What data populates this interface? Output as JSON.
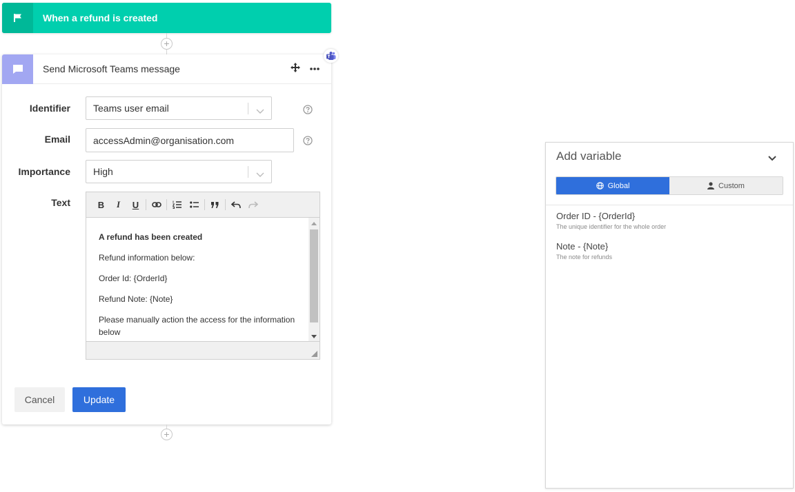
{
  "trigger": {
    "title": "When a refund is created",
    "icon": "flag-icon",
    "color": "#00cfae"
  },
  "action": {
    "title": "Send Microsoft Teams message",
    "icon": "chat-bubble-icon",
    "color": "#a2a7f2",
    "menu_icon": "more-horizontal-icon",
    "move_icon": "move-icon",
    "badge_icon": "teams-icon"
  },
  "form": {
    "identifier": {
      "label": "Identifier",
      "value": "Teams user email"
    },
    "email": {
      "label": "Email",
      "value": "accessAdmin@organisation.com"
    },
    "importance": {
      "label": "Importance",
      "value": "High"
    },
    "text": {
      "label": "Text",
      "toolbar": [
        "bold",
        "italic",
        "underline",
        "link",
        "ordered-list",
        "bullet-list",
        "blockquote",
        "undo",
        "redo"
      ],
      "toolbar_glyphs": {
        "bold": "B",
        "italic": "I",
        "underline": "U"
      },
      "lines": [
        "A refund has been created",
        "Refund information below:",
        "Order Id: {OrderId}",
        "Refund Note: {Note}",
        "Please manually action the access for the information below"
      ]
    }
  },
  "buttons": {
    "cancel": "Cancel",
    "update": "Update"
  },
  "variables_panel": {
    "title": "Add variable",
    "tabs": [
      {
        "label": "Global",
        "icon": "globe-icon",
        "active": true
      },
      {
        "label": "Custom",
        "icon": "user-icon",
        "active": false
      }
    ],
    "items": [
      {
        "name": "Order ID - {OrderId}",
        "description": "The unique identifier for the whole order"
      },
      {
        "name": "Note - {Note}",
        "description": "The note for refunds"
      }
    ]
  },
  "colors": {
    "primary": "#2f6fdc",
    "accent": "#00cfae"
  }
}
